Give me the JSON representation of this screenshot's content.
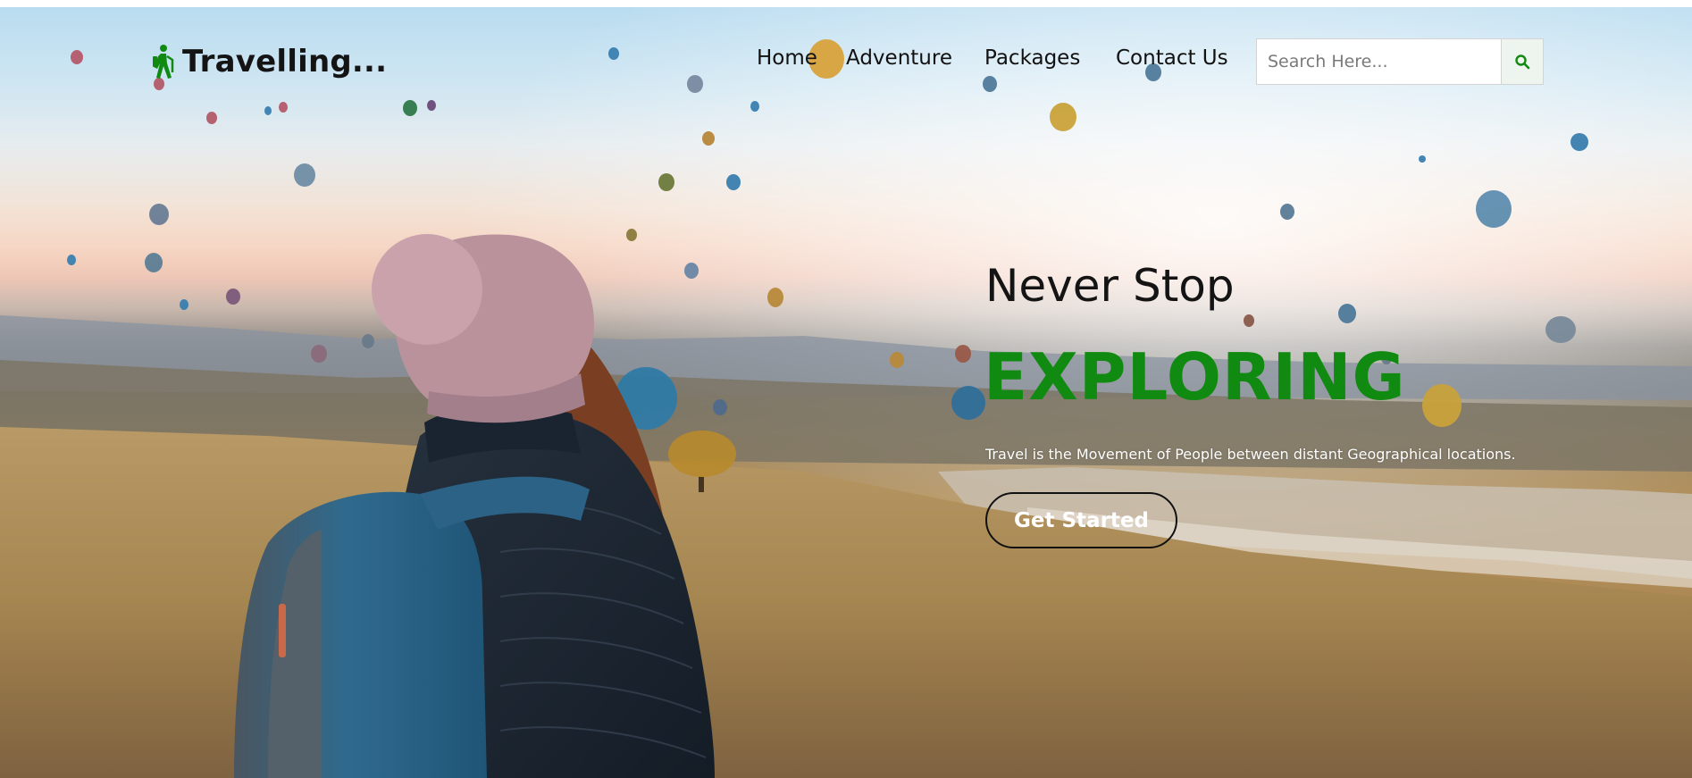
{
  "brand": {
    "name": "Travelling...",
    "icon": "hiker-icon",
    "color": "#108a10"
  },
  "nav": {
    "items": [
      {
        "label": "Home"
      },
      {
        "label": "Adventure"
      },
      {
        "label": "Packages"
      },
      {
        "label": "Contact Us"
      }
    ]
  },
  "search": {
    "placeholder": "Search Here...",
    "value": "",
    "icon": "search-icon"
  },
  "hero": {
    "headline": "Never Stop",
    "highlight": "EXPLORING",
    "highlight_color": "#108a10",
    "tagline": "Travel is the Movement of People between distant Geographical locations.",
    "cta_label": "Get Started"
  }
}
